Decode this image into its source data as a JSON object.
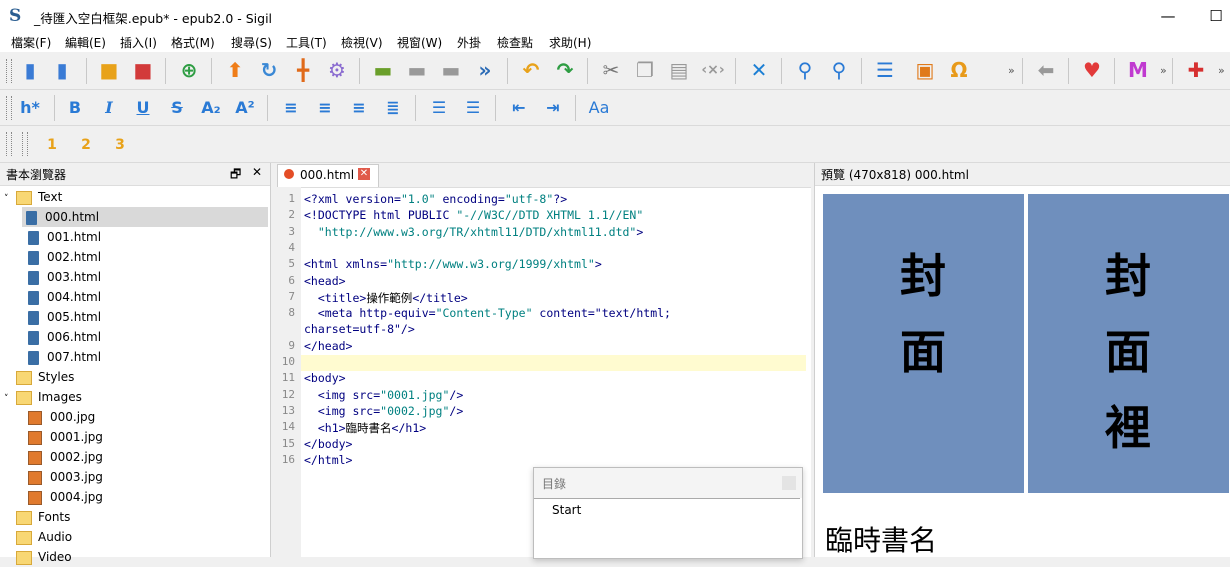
{
  "window": {
    "title": "_待匯入空白框架.epub* - epub2.0 - Sigil",
    "logo_text": "S",
    "minimize_glyph": "—",
    "maximize_glyph": "☐"
  },
  "menu": [
    "檔案(F)",
    "編輯(E)",
    "插入(I)",
    "格式(M)",
    "搜尋(S)",
    "工具(T)",
    "檢視(V)",
    "視窗(W)",
    "外掛",
    "檢查點",
    "求助(H)"
  ],
  "toolbar1": {
    "overflow": [
      "»",
      "»",
      "»",
      "»"
    ]
  },
  "toolbar2": {
    "heading_label": "h*",
    "bold": "B",
    "italic": "I",
    "underline": "U",
    "strike": "S",
    "subscript": "A₂",
    "superscript": "A²",
    "font_case": "Aa"
  },
  "toolbar3": {
    "levels": [
      "1",
      "2",
      "3"
    ]
  },
  "book_browser": {
    "title": "書本瀏覽器",
    "float_glyph": "🗗",
    "close_glyph": "✕",
    "items": [
      {
        "label": "Text",
        "type": "folder",
        "expanded": true
      },
      {
        "label": "000.html",
        "type": "file",
        "selected": true
      },
      {
        "label": "001.html",
        "type": "file"
      },
      {
        "label": "002.html",
        "type": "file"
      },
      {
        "label": "003.html",
        "type": "file"
      },
      {
        "label": "004.html",
        "type": "file"
      },
      {
        "label": "005.html",
        "type": "file"
      },
      {
        "label": "006.html",
        "type": "file"
      },
      {
        "label": "007.html",
        "type": "file"
      },
      {
        "label": "Styles",
        "type": "folder"
      },
      {
        "label": "Images",
        "type": "folder",
        "expanded": true
      },
      {
        "label": "000.jpg",
        "type": "image"
      },
      {
        "label": "0001.jpg",
        "type": "image"
      },
      {
        "label": "0002.jpg",
        "type": "image"
      },
      {
        "label": "0003.jpg",
        "type": "image"
      },
      {
        "label": "0004.jpg",
        "type": "image"
      },
      {
        "label": "Fonts",
        "type": "folder"
      },
      {
        "label": "Audio",
        "type": "folder"
      },
      {
        "label": "Video",
        "type": "folder"
      }
    ]
  },
  "editor": {
    "tab_label": "000.html",
    "line_numbers": [
      "1",
      "2",
      "3",
      "4",
      "5",
      "6",
      "7",
      "8",
      "9",
      "10",
      "11",
      "12",
      "13",
      "14",
      "15",
      "16"
    ],
    "lines": [
      "<?xml version=\"1.0\" encoding=\"utf-8\"?>",
      "<!DOCTYPE html PUBLIC \"-//W3C//DTD XHTML 1.1//EN\"",
      "  \"http://www.w3.org/TR/xhtml11/DTD/xhtml11.dtd\">",
      "",
      "<html xmlns=\"http://www.w3.org/1999/xhtml\">",
      "<head>",
      "  <title>操作範例</title>",
      "  <meta http-equiv=\"Content-Type\" content=\"text/html;",
      "charset=utf-8\"/>",
      "</head>",
      "",
      "<body>",
      "  <img src=\"0001.jpg\"/>",
      "  <img src=\"0002.jpg\"/>",
      "  <h1>臨時書名</h1>",
      "</body>",
      "</html>"
    ]
  },
  "preview": {
    "title": "預覽 (470x818) 000.html",
    "cover1": [
      "封",
      "面"
    ],
    "cover2": [
      "封",
      "面",
      "裡"
    ],
    "heading": "臨時書名"
  },
  "toc": {
    "title": "目錄",
    "entry": "Start"
  },
  "colors": {
    "cover_bg": "#6f8fbd",
    "current_line": "#fffbd0",
    "selected_row": "#d9d9d9"
  }
}
